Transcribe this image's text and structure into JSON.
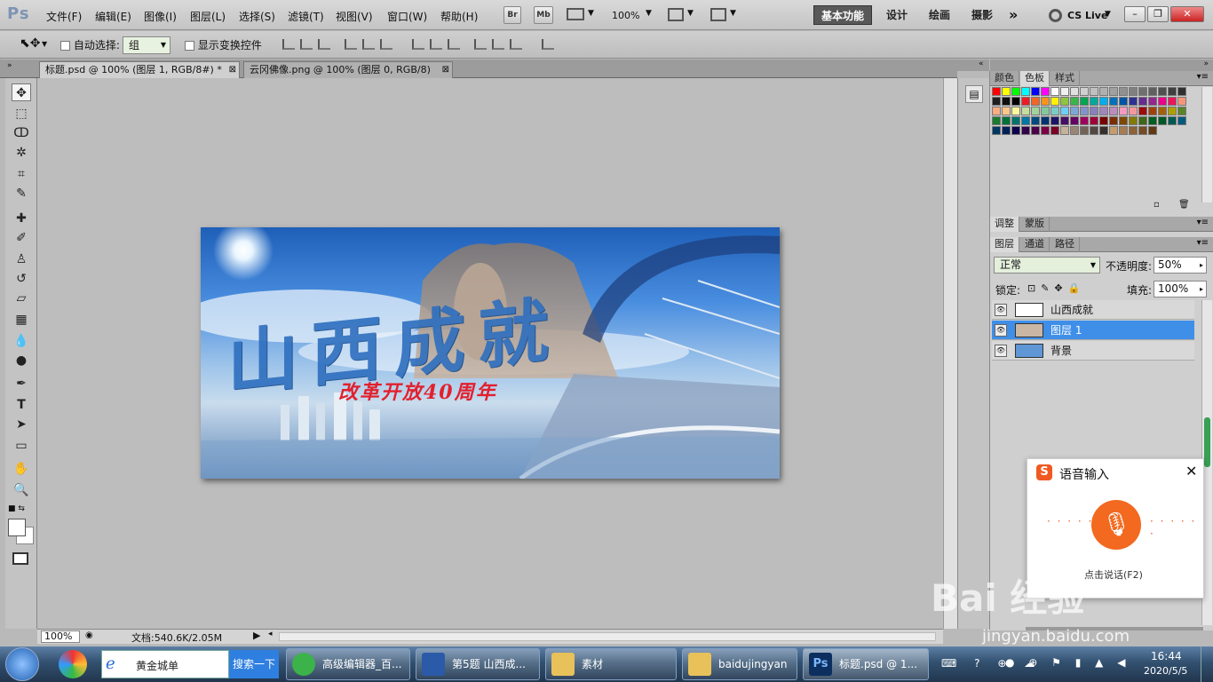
{
  "app": {
    "logo": "Ps"
  },
  "menu": [
    "文件(F)",
    "编辑(E)",
    "图像(I)",
    "图层(L)",
    "选择(S)",
    "滤镜(T)",
    "视图(V)",
    "窗口(W)",
    "帮助(H)"
  ],
  "menubar_buttons": {
    "br": "Br",
    "mb": "Mb",
    "zoom": "100%"
  },
  "workspaces": [
    "基本功能",
    "设计",
    "绘画",
    "摄影"
  ],
  "cs_live": "CS Live",
  "options": {
    "auto_select_label": "自动选择:",
    "auto_select_value": "组",
    "show_transform_label": "显示变换控件"
  },
  "doc_tabs": [
    {
      "label": "标题.psd @ 100% (图层 1, RGB/8#) *"
    },
    {
      "label": "云冈佛像.png @ 100% (图层 0, RGB/8)"
    }
  ],
  "artwork": {
    "title": "山西成就",
    "subtitle": "改革开放40周年"
  },
  "status": {
    "zoom": "100%",
    "doc": "文档:540.6K/2.05M"
  },
  "panels": {
    "top_tabs": [
      "颜色",
      "色板",
      "样式"
    ],
    "mid_tabs": [
      "调整",
      "蒙版"
    ],
    "layer_tabs": [
      "图层",
      "通道",
      "路径"
    ],
    "blend_mode": "正常",
    "opacity_label": "不透明度:",
    "opacity_value": "50%",
    "lock_label": "锁定:",
    "fill_label": "填充:",
    "fill_value": "100%",
    "layers": [
      {
        "name": "山西成就",
        "selected": false
      },
      {
        "name": "图层 1",
        "selected": true
      },
      {
        "name": "背景",
        "selected": false
      }
    ],
    "swatches": [
      "#ff0000",
      "#ffff00",
      "#00ff00",
      "#00ffff",
      "#0000ff",
      "#ff00ff",
      "#ffffff",
      "#f0f0f0",
      "#e0e0e0",
      "#d0d0d0",
      "#c0c0c0",
      "#b0b0b0",
      "#a0a0a0",
      "#909090",
      "#808080",
      "#707070",
      "#606060",
      "#505050",
      "#404040",
      "#303030",
      "#202020",
      "#101010",
      "#000000",
      "#ed1c24",
      "#f26522",
      "#f7941d",
      "#fff200",
      "#8dc63f",
      "#39b54a",
      "#00a651",
      "#00a99d",
      "#00aeef",
      "#0072bc",
      "#0054a6",
      "#2e3192",
      "#662d91",
      "#92278f",
      "#ec008c",
      "#ed145b",
      "#f69679",
      "#f9ad81",
      "#fdc689",
      "#fff799",
      "#c4df9b",
      "#a3d39c",
      "#82ca9c",
      "#7accc8",
      "#6dcff6",
      "#7da7d9",
      "#8393ca",
      "#8781bd",
      "#a186be",
      "#bd8cbf",
      "#f49ac1",
      "#f5989d",
      "#9e0b0f",
      "#a0410d",
      "#a36209",
      "#aba000",
      "#598527",
      "#1a7b30",
      "#007236",
      "#00746b",
      "#0076a3",
      "#004a80",
      "#003471",
      "#1b1464",
      "#440e62",
      "#630460",
      "#9e005d",
      "#9e0039",
      "#790000",
      "#7b2e00",
      "#7d4900",
      "#827b00",
      "#406618",
      "#005e20",
      "#005826",
      "#005952",
      "#005b7f",
      "#003663",
      "#002157",
      "#0d004c",
      "#32004b",
      "#4b0049",
      "#7b0046",
      "#7a0026",
      "#c7b299",
      "#998675",
      "#736357",
      "#534741",
      "#37302a",
      "#c69c6d",
      "#a67c52",
      "#8c6239",
      "#754c24",
      "#603913"
    ]
  },
  "voice": {
    "title": "语音输入",
    "hint": "点击说话(F2)"
  },
  "watermark": {
    "text": "Bai 经验",
    "url": "jingyan.baidu.com"
  },
  "taskbar": {
    "ie_label": "黄金城单",
    "search_button": "搜索一下",
    "items": [
      "高级编辑器_百...",
      "第5题 山西成...",
      "素材",
      "baidujingyan",
      "标题.psd @ 1..."
    ],
    "time": "16:44",
    "date": "2020/5/5"
  }
}
